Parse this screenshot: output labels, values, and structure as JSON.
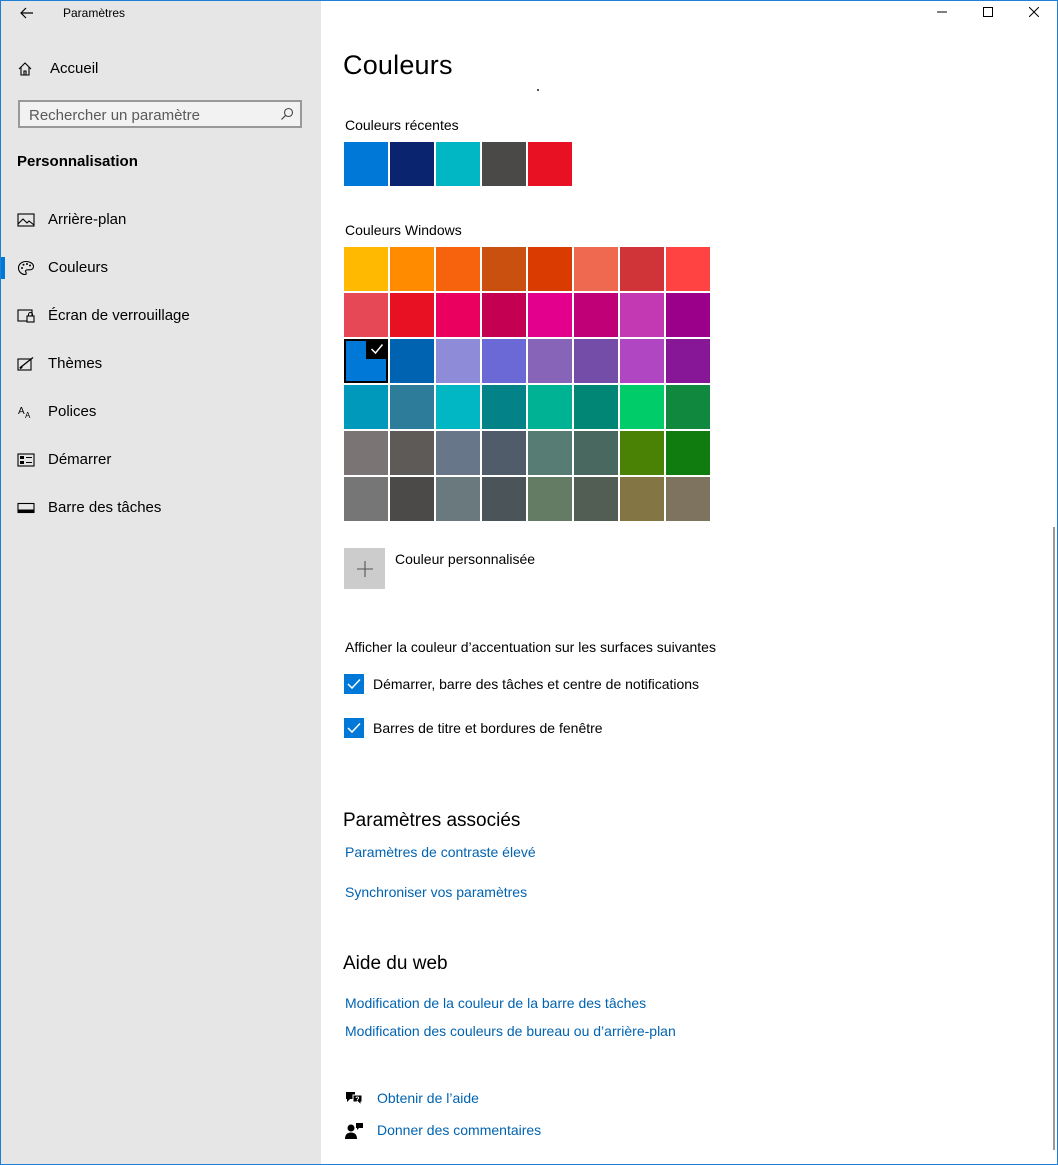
{
  "window": {
    "app_title": "Paramètres"
  },
  "sidebar": {
    "home_label": "Accueil",
    "search_placeholder": "Rechercher un paramètre",
    "section_title": "Personnalisation",
    "items": [
      {
        "label": "Arrière-plan",
        "icon": "picture-icon"
      },
      {
        "label": "Couleurs",
        "icon": "palette-icon",
        "active": true
      },
      {
        "label": "Écran de verrouillage",
        "icon": "lock-screen-icon"
      },
      {
        "label": "Thèmes",
        "icon": "themes-icon"
      },
      {
        "label": "Polices",
        "icon": "fonts-icon"
      },
      {
        "label": "Démarrer",
        "icon": "start-icon"
      },
      {
        "label": "Barre des tâches",
        "icon": "taskbar-icon"
      }
    ]
  },
  "main": {
    "title": "Couleurs",
    "recent_label": "Couleurs récentes",
    "recent_colors": [
      "#0078d7",
      "#0b2470",
      "#00b7c3",
      "#4a4948",
      "#e81123"
    ],
    "windows_label": "Couleurs Windows",
    "windows_colors": [
      [
        "#ffb900",
        "#ff8c00",
        "#f7630c",
        "#ca5010",
        "#da3b01",
        "#ef6950",
        "#d13438",
        "#ff4343"
      ],
      [
        "#e74856",
        "#e81123",
        "#ea005e",
        "#c30052",
        "#e3008c",
        "#bf0077",
        "#c239b3",
        "#9a0089"
      ],
      [
        "#0078d7",
        "#0063b1",
        "#8e8cd8",
        "#6b69d6",
        "#8764b8",
        "#744da9",
        "#b146c2",
        "#881798"
      ],
      [
        "#0099bc",
        "#2d7d9a",
        "#00b7c3",
        "#038387",
        "#00b294",
        "#018574",
        "#00cc6a",
        "#10893e"
      ],
      [
        "#7a7574",
        "#5d5a58",
        "#68768a",
        "#515c6b",
        "#567c73",
        "#486860",
        "#498205",
        "#107c10"
      ],
      [
        "#767676",
        "#4c4a48",
        "#69797e",
        "#4a5459",
        "#647c64",
        "#525e54",
        "#847545",
        "#7e735f"
      ]
    ],
    "selected_color": "#0078d7",
    "custom_label": "Couleur personnalisée",
    "accent_surfaces_label": "Afficher la couleur d’accentuation sur les surfaces suivantes",
    "checkbox_start": {
      "label": "Démarrer, barre des tâches et centre de notifications",
      "checked": true
    },
    "checkbox_titlebars": {
      "label": "Barres de titre et bordures de fenêtre",
      "checked": true
    },
    "related_title": "Paramètres associés",
    "related_links": [
      "Paramètres de contraste élevé",
      "Synchroniser vos paramètres"
    ],
    "web_help_title": "Aide du web",
    "web_help_links": [
      "Modification de la couleur de la barre des tâches",
      "Modification des couleurs de bureau ou d’arrière-plan"
    ],
    "get_help": "Obtenir de l’aide",
    "give_feedback": "Donner des commentaires"
  },
  "colors": {
    "accent": "#0078d7",
    "link": "#0063b1",
    "sidebar_bg": "#e6e6e6"
  }
}
